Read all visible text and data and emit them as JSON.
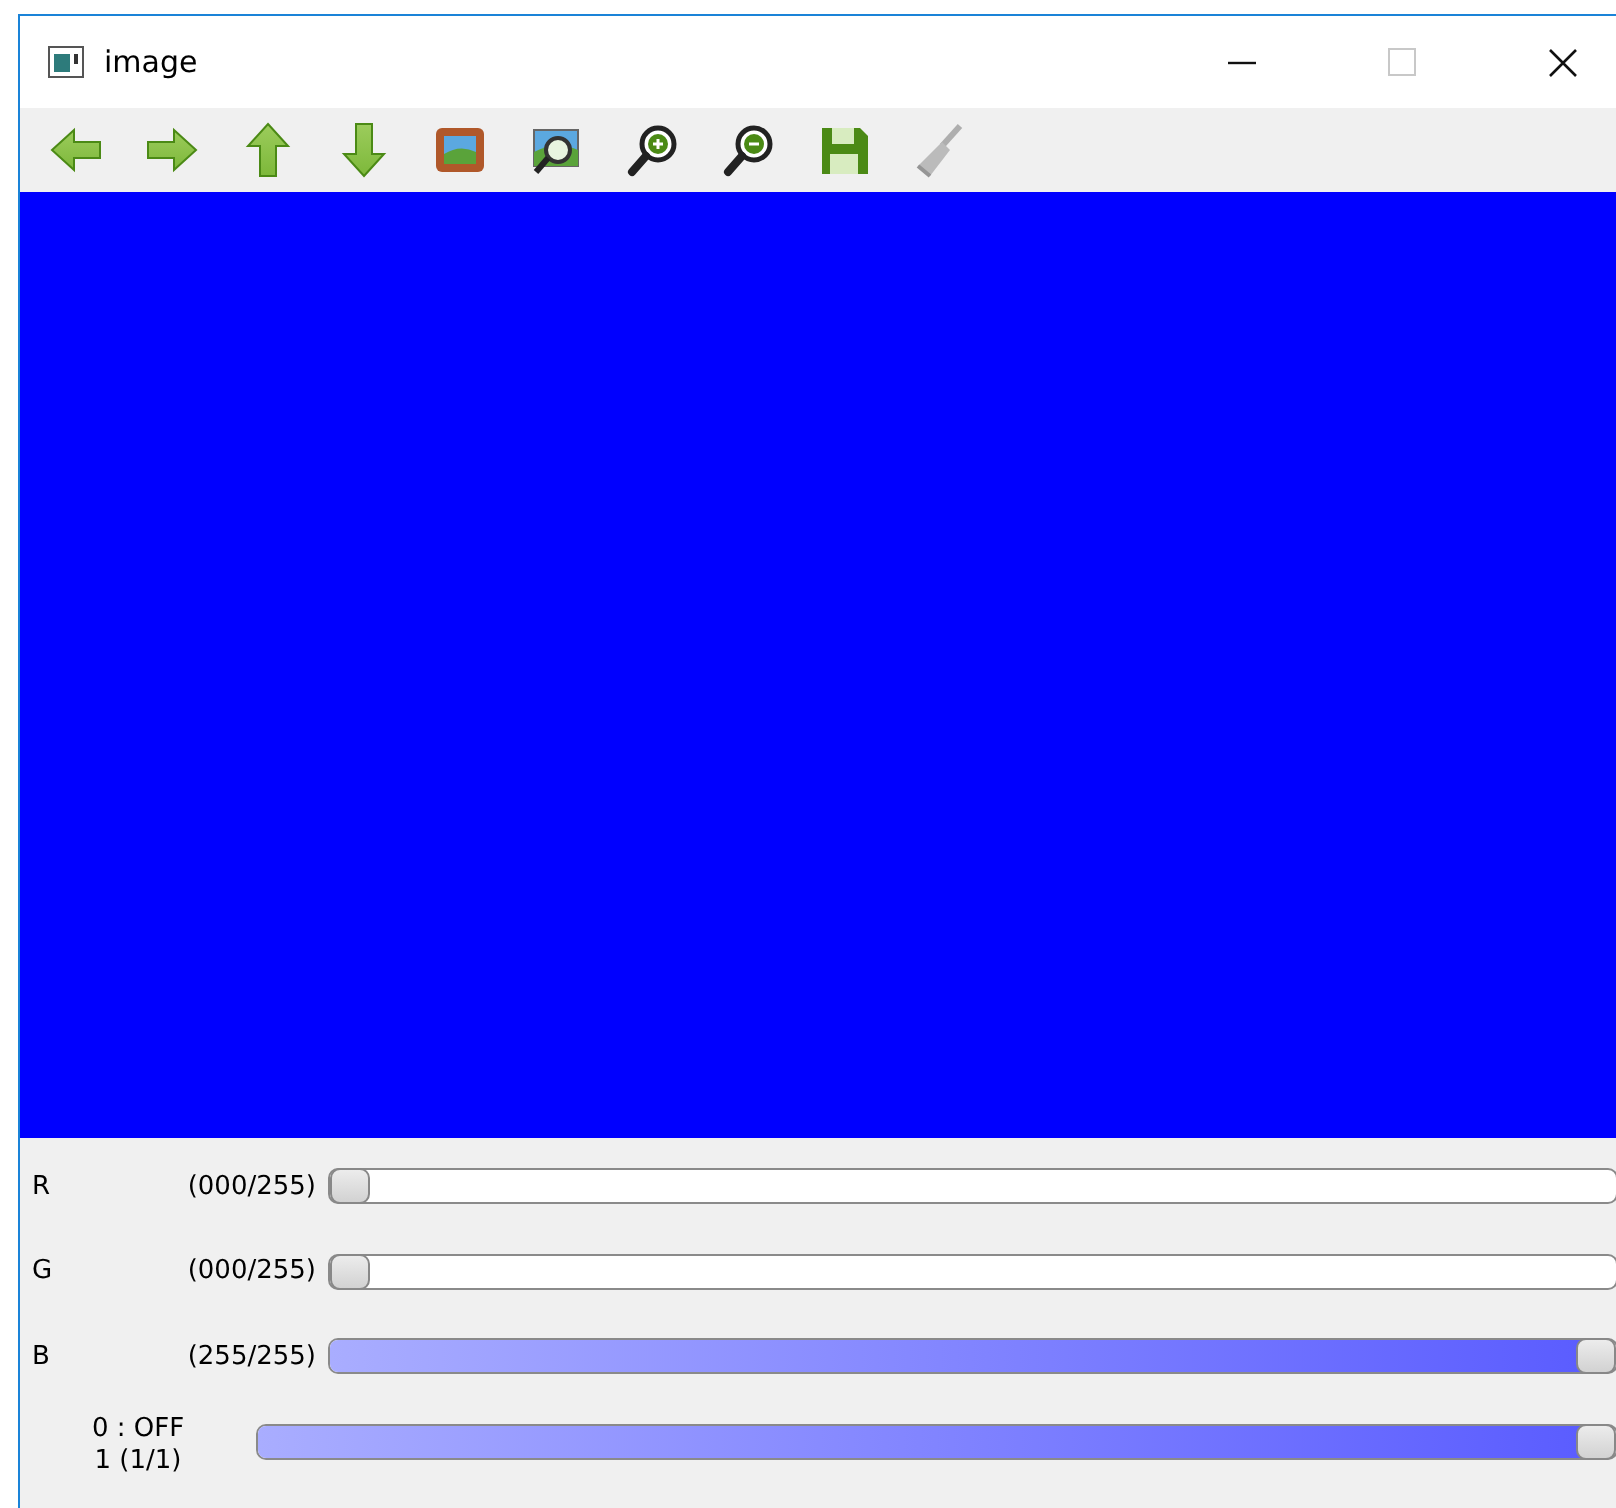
{
  "window": {
    "title": "image"
  },
  "toolbar": [
    {
      "kind": "arrow-left",
      "disabled": false
    },
    {
      "kind": "arrow-right",
      "disabled": false
    },
    {
      "kind": "arrow-up",
      "disabled": false
    },
    {
      "kind": "arrow-down",
      "disabled": false
    },
    {
      "kind": "picture",
      "disabled": false
    },
    {
      "kind": "zoom-fit",
      "disabled": false
    },
    {
      "kind": "zoom-in",
      "disabled": false
    },
    {
      "kind": "zoom-out",
      "disabled": false
    },
    {
      "kind": "save",
      "disabled": false
    },
    {
      "kind": "broom",
      "disabled": true
    }
  ],
  "sliders": [
    {
      "kind": "channel",
      "label": "R",
      "reading": "(000/255)",
      "level": 0
    },
    {
      "kind": "channel",
      "label": "G",
      "reading": "(000/255)",
      "level": 0
    },
    {
      "kind": "channel",
      "label": "B",
      "reading": "(255/255)",
      "level": 1
    },
    {
      "kind": "switch",
      "label": "0 : OFF",
      "reading": "1 (1/1)",
      "level": 1
    }
  ]
}
